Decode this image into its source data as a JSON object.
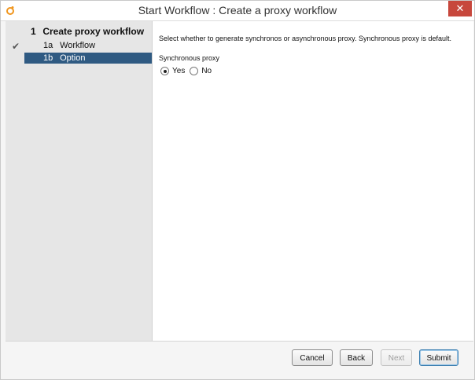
{
  "window": {
    "title": "Start Workflow : Create a proxy workflow",
    "close_label": "✕",
    "app_icon": "orchestrator-app-icon"
  },
  "steps": {
    "main_number": "1",
    "main_label": "Create proxy workflow",
    "items": [
      {
        "number": "1a",
        "label": "Workflow",
        "completed": true
      },
      {
        "number": "1b",
        "label": "Option",
        "active": true
      }
    ]
  },
  "content": {
    "description": "Select whether to generate synchronos or asynchronous proxy. Synchronous proxy is default.",
    "field_label": "Synchronous proxy",
    "options": [
      {
        "label": "Yes",
        "selected": true
      },
      {
        "label": "No",
        "selected": false
      }
    ]
  },
  "footer": {
    "cancel": "Cancel",
    "back": "Back",
    "next": "Next",
    "submit": "Submit"
  },
  "colors": {
    "active_step_bg": "#2f5a82",
    "close_bg": "#c7473c"
  }
}
